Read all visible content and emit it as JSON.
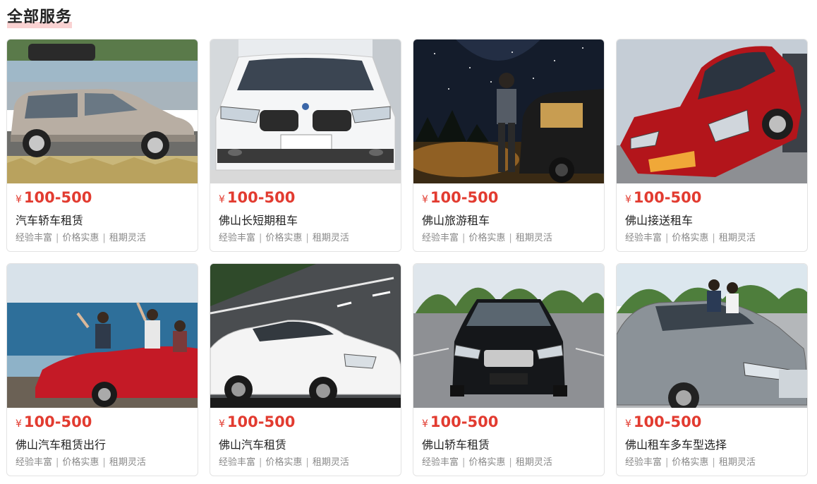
{
  "section": {
    "title": "全部服务"
  },
  "cards": [
    {
      "currency": "¥",
      "price": "100-500",
      "title": "汽车轿车租赁",
      "tags": [
        "经验丰富",
        "价格实惠",
        "租期灵活"
      ],
      "scene": "silver minivan with roof bag by the lake"
    },
    {
      "currency": "¥",
      "price": "100-500",
      "title": "佛山长短期租车",
      "tags": [
        "经验丰富",
        "价格实惠",
        "租期灵活"
      ],
      "scene": "white sedan front view"
    },
    {
      "currency": "¥",
      "price": "100-500",
      "title": "佛山旅游租车",
      "tags": [
        "经验丰富",
        "价格实惠",
        "租期灵活"
      ],
      "scene": "man beside SUV under starry night sky"
    },
    {
      "currency": "¥",
      "price": "100-500",
      "title": "佛山接送租车",
      "tags": [
        "经验丰富",
        "价格实惠",
        "租期灵活"
      ],
      "scene": "red sedan front three-quarter view"
    },
    {
      "currency": "¥",
      "price": "100-500",
      "title": "佛山汽车租赁出行",
      "tags": [
        "经验丰富",
        "价格实惠",
        "租期灵活"
      ],
      "scene": "red convertible by the sea with people"
    },
    {
      "currency": "¥",
      "price": "100-500",
      "title": "佛山汽车租赁",
      "tags": [
        "经验丰富",
        "价格实惠",
        "租期灵活"
      ],
      "scene": "white sedan on road"
    },
    {
      "currency": "¥",
      "price": "100-500",
      "title": "佛山轿车租赁",
      "tags": [
        "经验丰富",
        "价格实惠",
        "租期灵活"
      ],
      "scene": "black sedan front in parking lot"
    },
    {
      "currency": "¥",
      "price": "100-500",
      "title": "佛山租车多车型选择",
      "tags": [
        "经验丰富",
        "价格实惠",
        "租期灵活"
      ],
      "scene": "grey sedan with couple"
    }
  ],
  "colors": {
    "price": "#e23b30",
    "title_accent": "#eb5f5f",
    "tag": "#888888",
    "border": "#e3e3e3"
  }
}
